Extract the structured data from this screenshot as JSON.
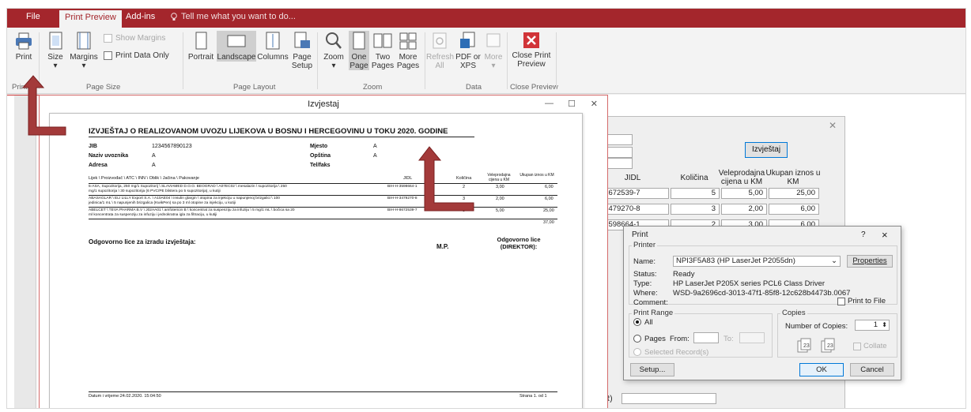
{
  "tabs": {
    "file": "File",
    "print_preview": "Print Preview",
    "addins": "Add-ins",
    "tell_me": "Tell me what you want to do..."
  },
  "ribbon": {
    "print": "Print",
    "size": "Size",
    "margins": "Margins",
    "show_margins": "Show Margins",
    "print_data_only": "Print Data Only",
    "portrait": "Portrait",
    "landscape": "Landscape",
    "columns": "Columns",
    "page_setup": "Page Setup",
    "zoom": "Zoom",
    "one_page": "One Page",
    "two_pages": "Two Pages",
    "more_pages": "More Pages",
    "refresh_all": "Refresh All",
    "pdf_xps": "PDF or XPS",
    "more": "More",
    "close_print_preview": "Close Print Preview",
    "groups": {
      "print": "Print",
      "page_size": "Page Size",
      "page_layout": "Page Layout",
      "zoom": "Zoom",
      "data": "Data",
      "close_preview": "Close Preview"
    }
  },
  "report": {
    "window_title": "Izvjestaj",
    "heading": "IZVJEŠTAJ O REALIZOVANOM UVOZU LIJEKOVA U BOSNU I HERCEGOVINU U TOKU 2020. GODINE",
    "jib_label": "JIB",
    "jib_value": "1234567890123",
    "naziv_label": "Naziv uvoznika",
    "naziv_value": "A",
    "adresa_label": "Adresa",
    "adresa_value": "A",
    "mjesto_label": "Mjesto",
    "mjesto_value": "A",
    "opstina_label": "Opština",
    "opstina_value": "A",
    "telfaks_label": "Tel/faks",
    "col_lijek": "Lijek \\ Proizvođač \\ ATC \\ INN \\ Oblik \\ Jačina \\ Pakovanje",
    "col_jidl": "JIDL",
    "col_kolicina": "Količina",
    "col_veleprodajna": "Veleprodajna cijena u KM",
    "col_ukupan": "Ukupan iznos u KM",
    "rows": [
      {
        "desc1": "5-ASA, Supozitorija, 250 mg/1 Supozitorij \\ SLAVIAMED D.O.O. BEOGRAD \\ A07EC02 \\ mesalazin \\ supozitorija \\ 250",
        "desc2": "mg/1 supozitorija \\ 30 supozitorija (6 PVC/PE blistera po 5 supozitorija), u kutiji",
        "jidl": "BIH-H-3598664-1",
        "qty": "2",
        "price": "3,00",
        "total": "6,00"
      },
      {
        "desc1": "ABASAGLAR \\ ELI LILLY Export S.A. \\ A10AE04 \\ insulin glargin \\ otopina za injekciju u napunjenoj brizgalici \\ 100",
        "desc2": "jedinica/1 mL \\ 5 napunjenih brizgalica (KwikPen) sa po 3 ml otopine za injekciju, u kutiji",
        "jidl": "BIH-H-3479270-8",
        "qty": "3",
        "price": "2,00",
        "total": "6,00"
      },
      {
        "desc1": "ABELCET \\ TEVA PHARMA B.V \\ J02AA01 \\ amfotericin B \\ koncentrat za suspenziju za infuziju \\ 5 mg/1 mL \\ bočica sa 20",
        "desc2": "ml koncentrata za suspenziju za infuziju i jednokratna igla za filtraciju, u kutiji",
        "jidl": "BIH-H-8672539-7",
        "qty": "5",
        "price": "5,00",
        "total": "25,00"
      }
    ],
    "sum_total": "37,00",
    "odgovorno": "Odgovorno lice za izradu izvještaja:",
    "mp": "M.P.",
    "odgovorno_dir": "Odgovorno lice (DIREKTOR):",
    "datum": "Datum i vrijeme:24.02.2020. 15:04:50",
    "strana": "Strana 1. od 1"
  },
  "bgform": {
    "button": "Izvještaj",
    "col_jidl": "JIDL",
    "col_kolicina": "Količina",
    "col_veleprodajna": "Veleprodajna cijena u KM",
    "col_ukupan": "Ukupan iznos u KM",
    "rows": [
      {
        "jidl": "-8672539-7",
        "qty": "5",
        "price": "5,00",
        "total": "25,00"
      },
      {
        "jidl": "-3479270-8",
        "qty": "3",
        "price": "2,00",
        "total": "6,00"
      },
      {
        "jidl": "-3598664-1",
        "qty": "2",
        "price": "3,00",
        "total": "6,00"
      }
    ],
    "bottom_label": "R)"
  },
  "print_dialog": {
    "title": "Print",
    "help": "?",
    "close": "×",
    "printer_group": "Printer",
    "name_label": "Name:",
    "name_value": "NPI3F5A83 (HP LaserJet P2055dn)",
    "properties": "Properties",
    "status_label": "Status:",
    "status_value": "Ready",
    "type_label": "Type:",
    "type_value": "HP LaserJet P205X series PCL6 Class Driver",
    "where_label": "Where:",
    "where_value": "WSD-9a2696cd-3013-47f1-85f8-12c628b4473b.0067",
    "comment_label": "Comment:",
    "print_to_file": "Print to File",
    "range_group": "Print Range",
    "all": "All",
    "pages": "Pages",
    "from": "From:",
    "to": "To:",
    "selected_records": "Selected Record(s)",
    "copies_group": "Copies",
    "number_of_copies": "Number of Copies:",
    "copies_value": "1",
    "collate": "Collate",
    "setup": "Setup...",
    "ok": "OK",
    "cancel": "Cancel"
  },
  "colors": {
    "accent": "#a4262c",
    "arrow": "#a33a3a"
  }
}
